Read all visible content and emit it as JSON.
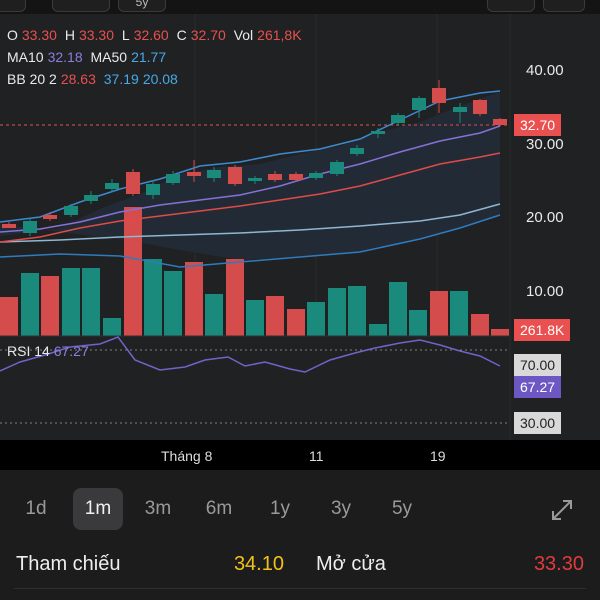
{
  "top_buttons": [
    "",
    "",
    "5y",
    "",
    ""
  ],
  "ohlc": {
    "o_label": "O",
    "o": "33.30",
    "h_label": "H",
    "h": "33.30",
    "l_label": "L",
    "l": "32.60",
    "c_label": "C",
    "c": "32.70",
    "vol_label": "Vol",
    "vol": "261,8K"
  },
  "ma": {
    "ma10_label": "MA10",
    "ma10": "32.18",
    "ma50_label": "MA50",
    "ma50": "21.77"
  },
  "bb": {
    "label": "BB 20 2",
    "upper": "28.63",
    "mid": "37.19",
    "lower": "20.08"
  },
  "price_axis": [
    "40.00",
    "30.00",
    "20.00",
    "10.00"
  ],
  "current_price": "32.70",
  "current_volume": "261.8K",
  "rsi": {
    "label": "RSI 14",
    "value": "67.27",
    "upper": "70.00",
    "lower": "30.00"
  },
  "x_labels": [
    "Tháng 8",
    "11",
    "19"
  ],
  "ranges": [
    "1d",
    "1m",
    "3m",
    "6m",
    "1y",
    "3y",
    "5y"
  ],
  "active_range": "1m",
  "stats": {
    "ref_label": "Tham chiếu",
    "ref_value": "34.10",
    "open_label": "Mở cửa",
    "open_value": "33.30"
  },
  "colors": {
    "up": "#2a9d8f",
    "down": "#e05a5a",
    "ref": "#f1c21b",
    "open": "#e03c3c"
  },
  "icons": [
    "expand-icon"
  ]
}
